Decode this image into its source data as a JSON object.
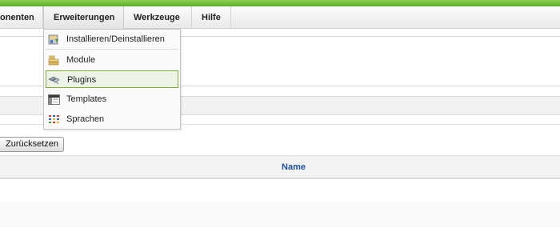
{
  "colors": {
    "accent_green": "#6cbf34",
    "header_blue": "#1c4f9c",
    "hover_border": "#7fae3a"
  },
  "menubar": {
    "items": [
      {
        "label": "onenten"
      },
      {
        "label": "Erweiterungen"
      },
      {
        "label": "Werkzeuge"
      },
      {
        "label": "Hilfe"
      }
    ]
  },
  "dropdown": {
    "items": [
      {
        "label": "Installieren/Deinstallieren",
        "icon": "install-package-icon"
      },
      {
        "label": "Module",
        "icon": "modules-icon"
      },
      {
        "label": "Plugins",
        "icon": "plugin-icon"
      },
      {
        "label": "Templates",
        "icon": "templates-icon"
      },
      {
        "label": "Sprachen",
        "icon": "languages-icon"
      }
    ],
    "highlighted": "Plugins"
  },
  "filter": {
    "reset_label": "Zurücksetzen"
  },
  "table": {
    "columns": [
      {
        "label": "Name"
      }
    ]
  }
}
